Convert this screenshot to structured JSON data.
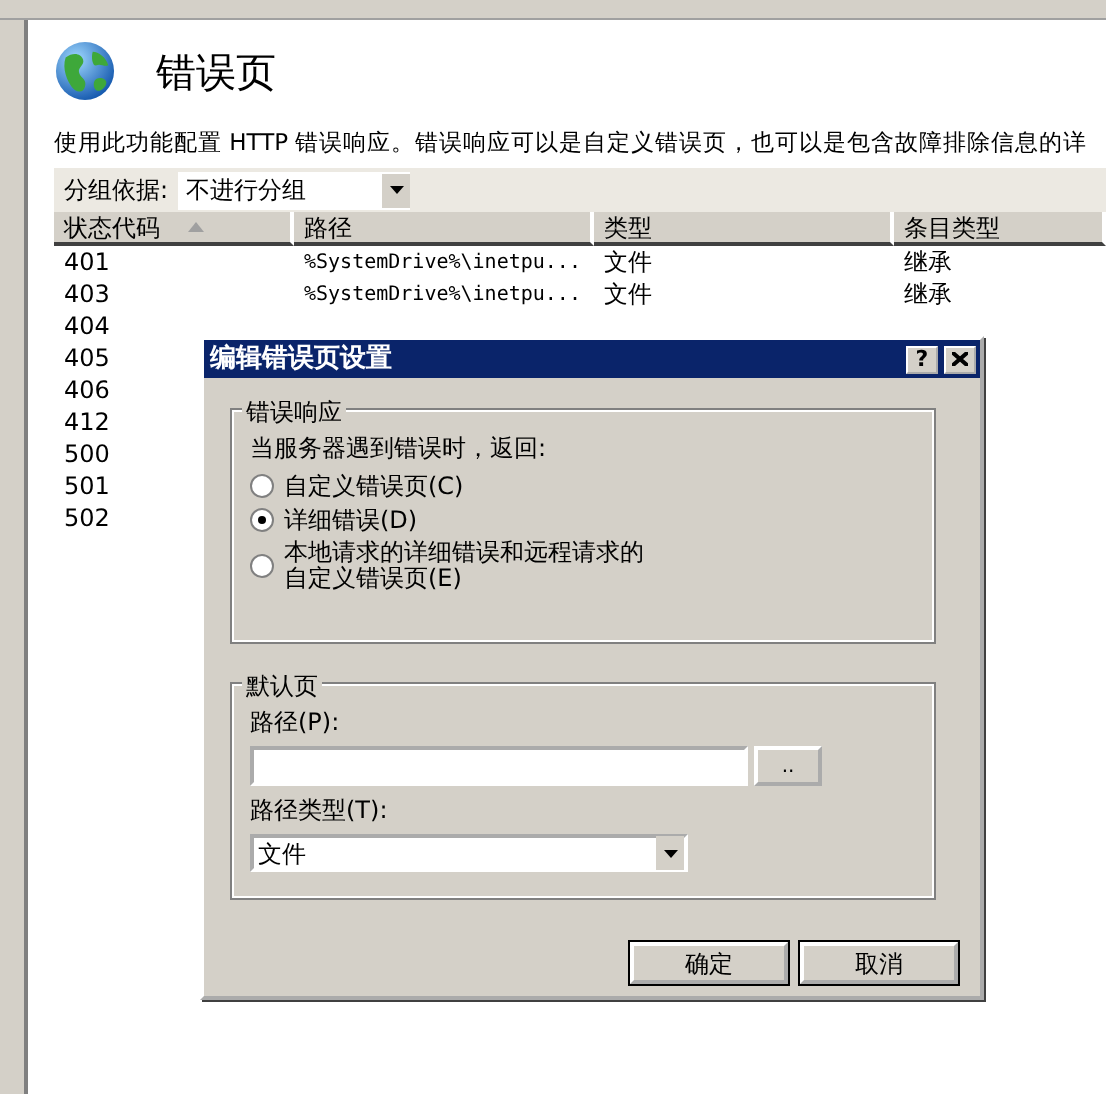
{
  "page": {
    "title": "错误页",
    "description": "使用此功能配置 HTTP 错误响应。错误响应可以是自定义错误页，也可以是包含故障排除信息的详",
    "group_by": {
      "label": "分组依据:",
      "value": "不进行分组"
    }
  },
  "table": {
    "columns": [
      {
        "label": "状态代码",
        "sorted": true
      },
      {
        "label": "路径",
        "sorted": false
      },
      {
        "label": "类型",
        "sorted": false
      },
      {
        "label": "条目类型",
        "sorted": false
      }
    ],
    "rows": [
      {
        "cells": [
          "401",
          "%SystemDrive%\\inetpu...",
          "文件",
          "继承"
        ]
      },
      {
        "cells": [
          "403",
          "%SystemDrive%\\inetpu...",
          "文件",
          "继承"
        ]
      },
      {
        "cells": [
          "404"
        ]
      },
      {
        "cells": [
          "405"
        ]
      },
      {
        "cells": [
          "406"
        ]
      },
      {
        "cells": [
          "412"
        ]
      },
      {
        "cells": [
          "500"
        ]
      },
      {
        "cells": [
          "501"
        ]
      },
      {
        "cells": [
          "502"
        ]
      }
    ]
  },
  "dialog": {
    "title": "编辑错误页设置",
    "help": "?",
    "response_group": {
      "legend": "错误响应",
      "prompt": "当服务器遇到错误时，返回:",
      "options": [
        {
          "label": "自定义错误页(C)",
          "selected": false
        },
        {
          "label": "详细错误(D)",
          "selected": true
        },
        {
          "label": "本地请求的详细错误和远程请求的自定义错误页(E)",
          "selected": false
        }
      ]
    },
    "default_group": {
      "legend": "默认页",
      "path_label": "路径(P):",
      "browse": "..",
      "path_type_label": "路径类型(T):",
      "path_type": "文件"
    },
    "buttons": [
      "确定",
      "取消"
    ]
  }
}
